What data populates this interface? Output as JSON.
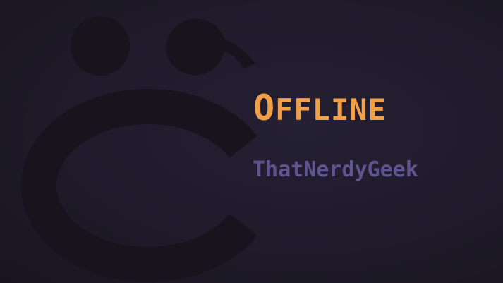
{
  "status": {
    "first_letter": "O",
    "rest": "FFLINE"
  },
  "channel_name": "ThatNerdyGeek",
  "icons": {
    "background": "sad-face-icon"
  },
  "colors": {
    "accent": "#f0a04b",
    "name": "#5e5490",
    "background": "#1f1b2b",
    "face": "#17141e"
  }
}
